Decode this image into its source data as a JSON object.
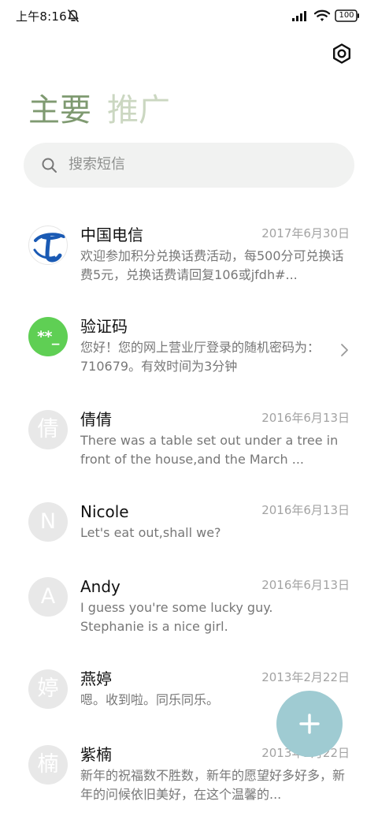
{
  "status_bar": {
    "time": "上午8:16",
    "battery": "100"
  },
  "header": {
    "settings_icon": "settings-hexagon-icon"
  },
  "tabs": [
    {
      "label": "主要",
      "active": true
    },
    {
      "label": "推广",
      "active": false
    }
  ],
  "search": {
    "placeholder": "搜索短信"
  },
  "conversations": [
    {
      "name": "中国电信",
      "date": "2017年6月30日",
      "preview": "欢迎参加积分兑换话费活动，每500分可兑换话费5元，兑换话费请回复106或jfdh#...",
      "avatar_type": "logo"
    },
    {
      "name": "验证码",
      "date": "",
      "preview": "您好！您的网上营业厅登录的随机密码为：710679。有效时间为3分钟",
      "avatar_type": "code",
      "avatar_text": "**_"
    },
    {
      "name": "倩倩",
      "date": "2016年6月13日",
      "preview": "There was a table set out under a tree in front of the house,and the March ...",
      "avatar_type": "letter",
      "avatar_text": "倩"
    },
    {
      "name": "Nicole",
      "date": "2016年6月13日",
      "preview": "Let's eat out,shall we?",
      "avatar_type": "letter",
      "avatar_text": "N"
    },
    {
      "name": "Andy",
      "date": "2016年6月13日",
      "preview": "I guess you're some lucky guy.Stephanie is a nice girl.",
      "avatar_type": "letter",
      "avatar_text": "A"
    },
    {
      "name": "燕婷",
      "date": "2013年2月22日",
      "preview": "嗯。收到啦。同乐同乐。",
      "avatar_type": "letter",
      "avatar_text": "婷"
    },
    {
      "name": "紫楠",
      "date": "2013年2月22日",
      "preview": "新年的祝福数不胜数，新年的愿望好多好多，新年的问候依旧美好，在这个温馨的...",
      "avatar_type": "letter",
      "avatar_text": "楠"
    }
  ],
  "fab": {
    "icon": "plus-icon"
  },
  "colors": {
    "active_tab": "#7f9a71",
    "inactive_tab": "#cbd7c1",
    "search_background": "#f1f2f1",
    "fab": "#9fcbd2",
    "code_avatar": "#5fcf54"
  }
}
